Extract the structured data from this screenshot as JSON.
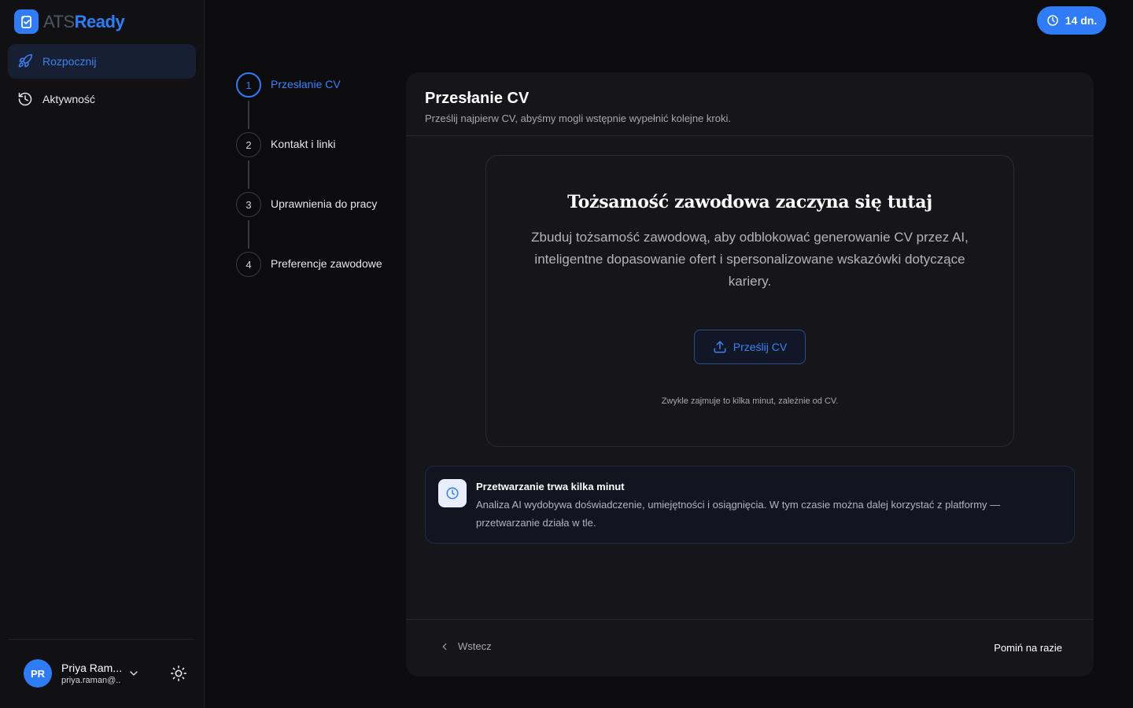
{
  "app": {
    "logo_prefix": "ATS",
    "logo_suffix": "Ready"
  },
  "sidebar": {
    "items": [
      {
        "label": "Rozpocznij",
        "icon": "rocket-icon",
        "active": true
      },
      {
        "label": "Aktywność",
        "icon": "history-icon",
        "active": false
      }
    ],
    "user": {
      "initials": "PR",
      "name": "Priya Ram...",
      "email": "priya.raman@..."
    }
  },
  "trial": {
    "label": "14 dn."
  },
  "stepper": {
    "steps": [
      {
        "number": "1",
        "label": "Przesłanie CV",
        "active": true
      },
      {
        "number": "2",
        "label": "Kontakt i linki",
        "active": false
      },
      {
        "number": "3",
        "label": "Uprawnienia do pracy",
        "active": false
      },
      {
        "number": "4",
        "label": "Preferencje zawodowe",
        "active": false
      }
    ]
  },
  "card": {
    "title": "Przesłanie CV",
    "subtitle": "Prześlij najpierw CV, abyśmy mogli wstępnie wypełnić kolejne kroki.",
    "hero_title": "Tożsamość zawodowa zaczyna się tutaj",
    "hero_description": "Zbuduj tożsamość zawodową, aby odblokować generowanie CV przez AI, inteligentne dopasowanie ofert i spersonalizowane wskazówki dotyczące kariery.",
    "upload_button": "Prześlij CV",
    "upload_note": "Zwykle zajmuje to kilka minut, zależnie od CV.",
    "info_title": "Przetwarzanie trwa kilka minut",
    "info_text": "Analiza AI wydobywa doświadczenie, umiejętności i osiągnięcia. W tym czasie można dalej korzystać z platformy — przetwarzanie działa w tle.",
    "back_button": "Wstecz",
    "skip_button": "Pomiń na razie"
  },
  "colors": {
    "accent": "#2f7cf6",
    "background": "#0c0c0f",
    "card": "#16161a"
  }
}
